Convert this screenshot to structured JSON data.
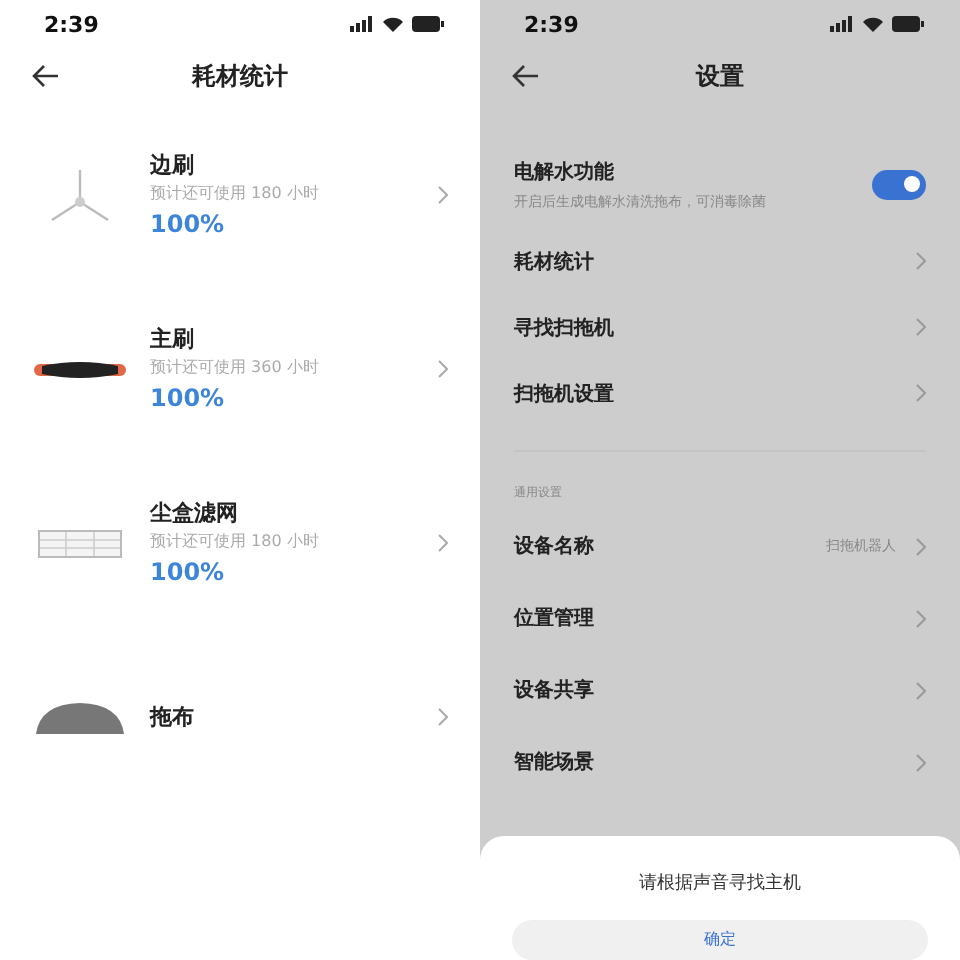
{
  "left": {
    "status_bar": {
      "time": "2:39"
    },
    "title": "耗材统计",
    "items": [
      {
        "kind": "side-brush",
        "name": "边刷",
        "remaining": "预计还可使用 180 小时",
        "percent": "100%"
      },
      {
        "kind": "main-brush",
        "name": "主刷",
        "remaining": "预计还可使用 360 小时",
        "percent": "100%"
      },
      {
        "kind": "filter",
        "name": "尘盒滤网",
        "remaining": "预计还可使用 180 小时",
        "percent": "100%"
      },
      {
        "kind": "mop",
        "name": "拖布"
      }
    ]
  },
  "right": {
    "status_bar": {
      "time": "2:39"
    },
    "title": "设置",
    "toggle": {
      "label": "电解水功能",
      "description": "开启后生成电解水清洗拖布，可消毒除菌",
      "on": true
    },
    "items": [
      {
        "label": "耗材统计"
      },
      {
        "label": "寻找扫拖机"
      },
      {
        "label": "扫拖机设置"
      }
    ],
    "section": "通用设置",
    "general_items": [
      {
        "label": "设备名称",
        "value": "扫拖机器人"
      },
      {
        "label": "位置管理"
      },
      {
        "label": "设备共享"
      },
      {
        "label": "智能场景"
      }
    ],
    "sheet": {
      "message": "请根据声音寻找主机",
      "button": "确定"
    }
  }
}
